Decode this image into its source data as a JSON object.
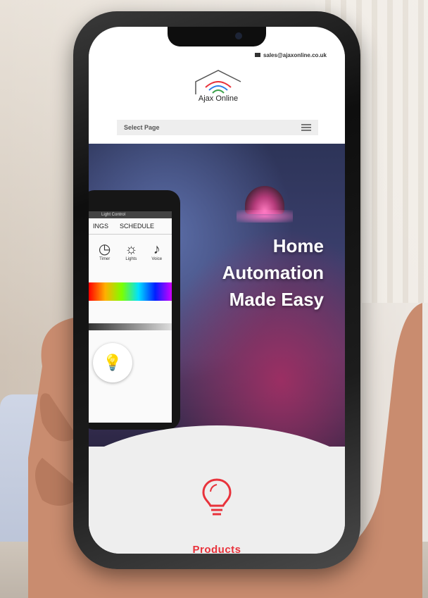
{
  "topbar": {
    "email": "sales@ajaxonline.co.uk"
  },
  "logo": {
    "text": "Ajax Online"
  },
  "nav": {
    "select_label": "Select Page"
  },
  "hero": {
    "title_line1": "Home",
    "title_line2": "Automation",
    "title_line3": "Made Easy"
  },
  "inner_app": {
    "title": "Light Control",
    "tabs": [
      "INGS",
      "SCHEDULE"
    ],
    "icons": [
      {
        "name": "clock-icon",
        "label": "Timer"
      },
      {
        "name": "bulb-icon",
        "label": "Lights"
      },
      {
        "name": "mic-icon",
        "label": "Voice"
      }
    ]
  },
  "products": {
    "label": "Products"
  },
  "colors": {
    "accent": "#e8323b",
    "hero_bg": "#3b3f6d",
    "nav_bg": "#eeeeee"
  }
}
